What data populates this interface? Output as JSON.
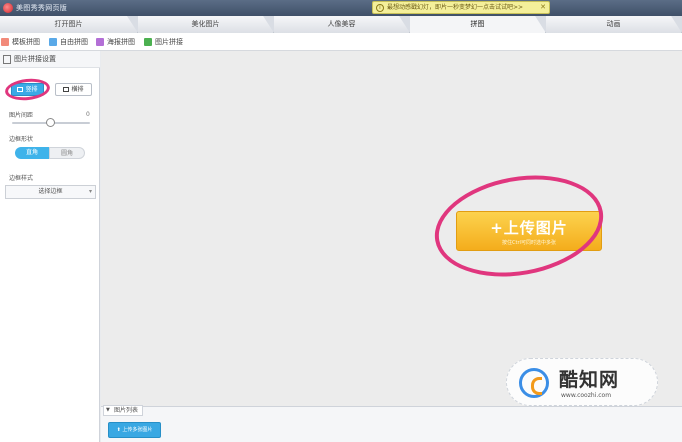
{
  "window": {
    "title": "美图秀秀网页版"
  },
  "promo": {
    "text": "最想动感戳幻灯，即片一秒变梦幻一点击试试吧>>",
    "close": "✕"
  },
  "tabs": [
    {
      "label": "打开图片"
    },
    {
      "label": "美化图片"
    },
    {
      "label": "人像美容"
    },
    {
      "label": "拼图",
      "active": true
    },
    {
      "label": "动画"
    }
  ],
  "toolbar": {
    "items": [
      {
        "label": "模板拼图",
        "color": "#f28a7a"
      },
      {
        "label": "自由拼图",
        "color": "#5aa9e8"
      },
      {
        "label": "海报拼图",
        "color": "#b36fd6"
      },
      {
        "label": "图片拼接",
        "color": "#4cb050"
      }
    ]
  },
  "panel": {
    "header": "图片拼接设置",
    "layout_vertical": "竖排",
    "layout_horizontal": "横排",
    "spacing_label": "图片间距",
    "spacing_value": "0",
    "border_shape_label": "边框形状",
    "shape_square": "直角",
    "shape_round": "圆角",
    "border_style_label": "边框样式",
    "border_style_select": "选择边框"
  },
  "canvas": {
    "upload_label": "+上传图片",
    "upload_hint": "按住Ctrl可同时选中多张"
  },
  "watermark": {
    "name": "酷知网",
    "url": "www.coozhi.com"
  },
  "tray": {
    "tab_label": "图片列表",
    "upload_more": "上传多张图片"
  }
}
